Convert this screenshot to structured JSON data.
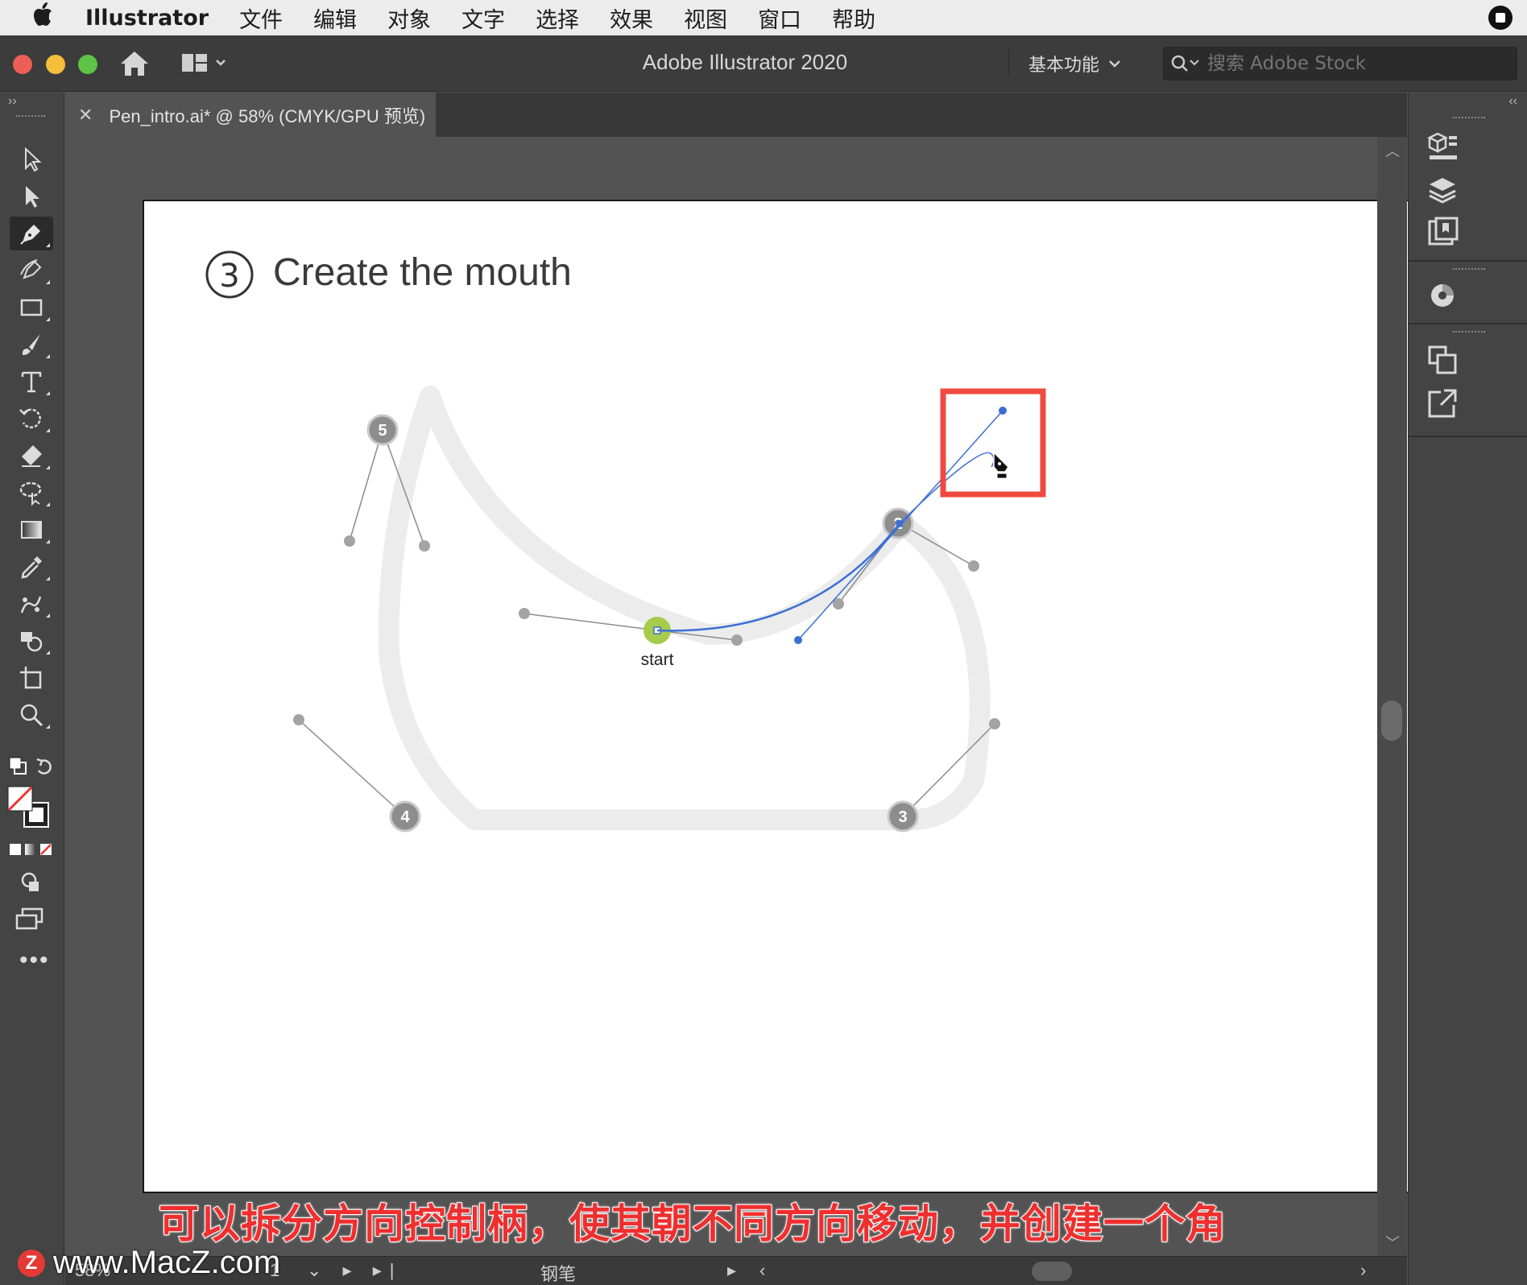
{
  "menubar": {
    "app_name": "Illustrator",
    "items": [
      "文件",
      "编辑",
      "对象",
      "文字",
      "选择",
      "效果",
      "视图",
      "窗口",
      "帮助"
    ]
  },
  "titlebar": {
    "title": "Adobe Illustrator 2020",
    "workspace": "基本功能",
    "search_placeholder": "搜索 Adobe Stock"
  },
  "document_tab": {
    "label": "Pen_intro.ai* @ 58% (CMYK/GPU 预览)"
  },
  "artboard": {
    "step_number": "3",
    "heading": "Create the mouth",
    "start_label": "start",
    "anchor_labels": [
      "5",
      "2",
      "3",
      "4"
    ]
  },
  "status_bar": {
    "zoom": "58%",
    "current_tool": "钢笔",
    "page_nav": "1"
  },
  "overlay": {
    "subtitle": "可以拆分方向控制柄，使其朝不同方向移动，并创建一个角",
    "watermark": "www.MacZ.com",
    "watermark_logo": "Z"
  },
  "colors": {
    "menubar_bg": "#ececec",
    "titlebar_bg": "#3c3c3c",
    "panel_bg": "#444444",
    "canvas_bg": "#535353",
    "artboard_bg": "#ffffff",
    "path_blue": "#3b6fd4",
    "start_green": "#a6cc4a",
    "highlight_red": "#ef4a3f",
    "subtitle_red": "#ef2f2f"
  },
  "icons": {
    "tools": [
      "selection-icon",
      "direct-selection-icon",
      "pen-icon",
      "curvature-icon",
      "rectangle-icon",
      "paintbrush-icon",
      "type-icon",
      "rotate-icon",
      "eraser-icon",
      "lasso-icon",
      "gradient-icon",
      "eyedropper-icon",
      "blend-icon",
      "shape-builder-icon",
      "artboard-icon",
      "zoom-icon"
    ],
    "right_panel": [
      "properties-icon",
      "layers-icon",
      "libraries-icon",
      "color-icon",
      "transform-icon",
      "export-icon"
    ]
  }
}
